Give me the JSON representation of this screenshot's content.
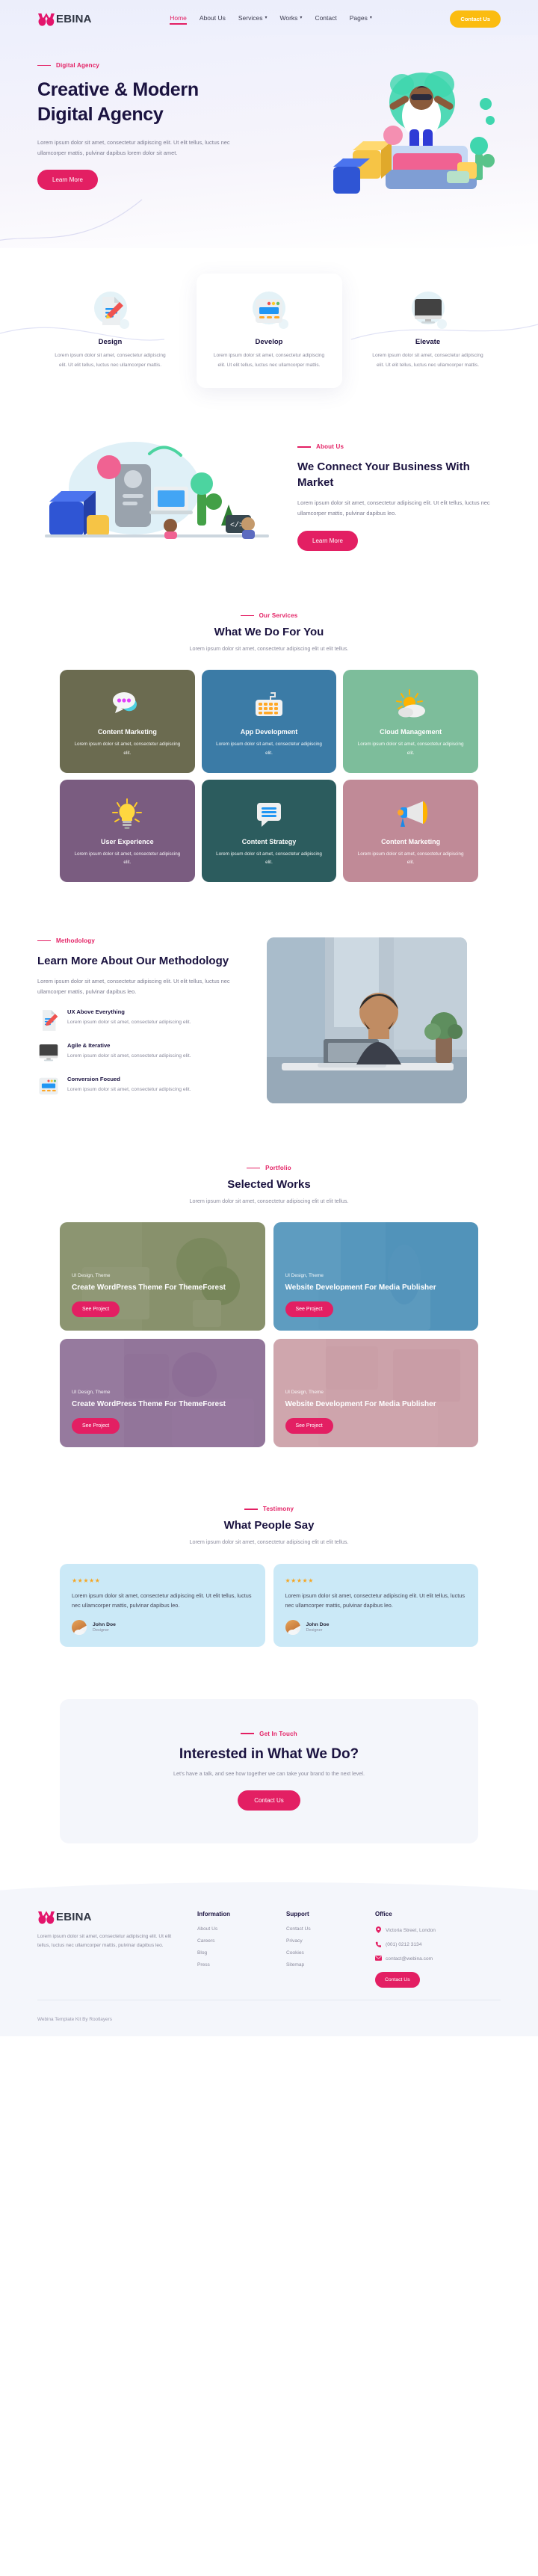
{
  "brand": {
    "name_bold": "W",
    "name_rest": "EBINA",
    "accent": "#e31f63",
    "dark": "#1b1340"
  },
  "header": {
    "nav": [
      {
        "label": "Home",
        "active": true,
        "caret": ""
      },
      {
        "label": "About Us",
        "active": false,
        "caret": ""
      },
      {
        "label": "Services",
        "active": false,
        "caret": "▾"
      },
      {
        "label": "Works",
        "active": false,
        "caret": "▾"
      },
      {
        "label": "Contact",
        "active": false,
        "caret": ""
      },
      {
        "label": "Pages",
        "active": false,
        "caret": "▾"
      }
    ],
    "cta_label": "Contact Us"
  },
  "hero": {
    "eyebrow": "Digital Agency",
    "title": "Creative & Modern Digital Agency",
    "body": "Lorem ipsum dolor sit amet, consectetur adipiscing elit. Ut elit tellus, luctus nec ullamcorper mattis, pulvinar dapibus lorem dolor sit amet.",
    "button": "Learn More"
  },
  "features": [
    {
      "icon": "document-pencil-icon",
      "title": "Design",
      "body": "Lorem ipsum dolor sit amet, consectetur adipiscing elit. Ut elit tellus, luctus nec ullamcorper mattis."
    },
    {
      "icon": "browser-window-icon",
      "title": "Develop",
      "body": "Lorem ipsum dolor sit amet, consectetur adipiscing elit. Ut elit tellus, luctus nec ullamcorper mattis."
    },
    {
      "icon": "desktop-monitor-icon",
      "title": "Elevate",
      "body": "Lorem ipsum dolor sit amet, consectetur adipiscing elit. Ut elit tellus, luctus nec ullamcorper mattis."
    }
  ],
  "about": {
    "eyebrow": "About Us",
    "title": "We Connect Your Business With Market",
    "body": "Lorem ipsum dolor sit amet, consectetur adipiscing elit. Ut elit tellus, luctus nec ullamcorper mattis, pulvinar dapibus leo.",
    "button": "Learn More"
  },
  "services": {
    "eyebrow": "Our Services",
    "title": "What We Do For You",
    "subtitle": "Lorem ipsum dolor sit amet, consectetur adipiscing elit ut elit tellus.",
    "cards": [
      {
        "title": "Content Marketing",
        "body": "Lorem ipsum dolor sit amet, consectetur adipiscing elit.",
        "bg": "#6b6b50",
        "icon": "chat-bubbles-icon"
      },
      {
        "title": "App Development",
        "body": "Lorem ipsum dolor sit amet, consectetur adipiscing elit.",
        "bg": "#3b7ba6",
        "icon": "keyboard-icon"
      },
      {
        "title": "Cloud Management",
        "body": "Lorem ipsum dolor sit amet, consectetur adipiscing elit.",
        "bg": "#7dbd9b",
        "icon": "sun-cloud-icon"
      },
      {
        "title": "User Experience",
        "body": "Lorem ipsum dolor sit amet, consectetur adipiscing elit.",
        "bg": "#7a5c80",
        "icon": "lightbulb-icon"
      },
      {
        "title": "Content Strategy",
        "body": "Lorem ipsum dolor sit amet, consectetur adipiscing elit.",
        "bg": "#2c5c5e",
        "icon": "message-lines-icon"
      },
      {
        "title": "Content Marketing",
        "body": "Lorem ipsum dolor sit amet, consectetur adipiscing elit.",
        "bg": "#c08a97",
        "icon": "megaphone-icon"
      }
    ]
  },
  "methodology": {
    "eyebrow": "Methodology",
    "title": "Learn More About Our Methodology",
    "body": "Lorem ipsum dolor sit amet, consectetur adipiscing elit. Ut elit tellus, luctus nec ullamcorper mattis, pulvinar dapibus leo.",
    "items": [
      {
        "icon": "document-pencil-icon",
        "title": "UX Above Everything",
        "body": "Lorem ipsum dolor sit amet, consectetur adipiscing elit."
      },
      {
        "icon": "desktop-monitor-icon",
        "title": "Agile & Iterative",
        "body": "Lorem ipsum dolor sit amet, consectetur adipiscing elit."
      },
      {
        "icon": "browser-window-icon",
        "title": "Conversion Focued",
        "body": "Lorem ipsum dolor sit amet, consectetur adipiscing elit."
      }
    ]
  },
  "portfolio": {
    "eyebrow": "Portfolio",
    "title": "Selected Works",
    "subtitle": "Lorem ipsum dolor sit amet, consectetur adipiscing elit ut elit tellus.",
    "cards": [
      {
        "tag": "UI Design, Theme",
        "title": "Create WordPress Theme For ThemeForest",
        "button": "See Project",
        "tint": "#6e7a4e"
      },
      {
        "tag": "UI Design, Theme",
        "title": "Website Development For Media Publisher",
        "button": "See Project",
        "tint": "#2f7fae"
      },
      {
        "tag": "UI Design, Theme",
        "title": "Create WordPress Theme For ThemeForest",
        "button": "See Project",
        "tint": "#7d5a86"
      },
      {
        "tag": "UI Design, Theme",
        "title": "Website Development For Media Publisher",
        "button": "See Project",
        "tint": "#c4929b"
      }
    ]
  },
  "testimony": {
    "eyebrow": "Testimony",
    "title": "What People Say",
    "subtitle": "Lorem ipsum dolor sit amet, consectetur adipiscing elit ut elit tellus.",
    "cards": [
      {
        "stars": "★★★★★",
        "quote": "Lorem ipsum dolor sit amet, consectetur adipiscing elit. Ut elit tellus, luctus nec ullamcorper mattis, pulvinar dapibus leo.",
        "name": "John Doe",
        "role": "Designer"
      },
      {
        "stars": "★★★★★",
        "quote": "Lorem ipsum dolor sit amet, consectetur adipiscing elit. Ut elit tellus, luctus nec ullamcorper mattis, pulvinar dapibus leo.",
        "name": "John Doe",
        "role": "Designer"
      }
    ]
  },
  "cta": {
    "eyebrow": "Get In Touch",
    "title": "Interested in What We Do?",
    "subtitle": "Let's have a talk, and see how together we can take your brand to the next level.",
    "button": "Contact Us"
  },
  "footer": {
    "about": "Lorem ipsum dolor sit amet, consectetur adipiscing elit. Ut elit tellus, luctus nec ullamcorper mattis, pulvinar dapibus leo.",
    "columns": [
      {
        "heading": "Information",
        "links": [
          "About Us",
          "Careers",
          "Blog",
          "Press"
        ]
      },
      {
        "heading": "Support",
        "links": [
          "Contact Us",
          "Privacy",
          "Cookies",
          "Sitemap"
        ]
      }
    ],
    "office": {
      "heading": "Office",
      "rows": [
        {
          "icon": "map-pin-icon",
          "glyph": "●",
          "text": "Victoria Street, London"
        },
        {
          "icon": "phone-icon",
          "glyph": "✆",
          "text": "(001) 0212 3134"
        },
        {
          "icon": "envelope-icon",
          "glyph": "✉",
          "text": "contact@webina.com"
        }
      ],
      "button": "Contact Us"
    },
    "copyright": "Webina Template Kit By Rootlayers"
  }
}
